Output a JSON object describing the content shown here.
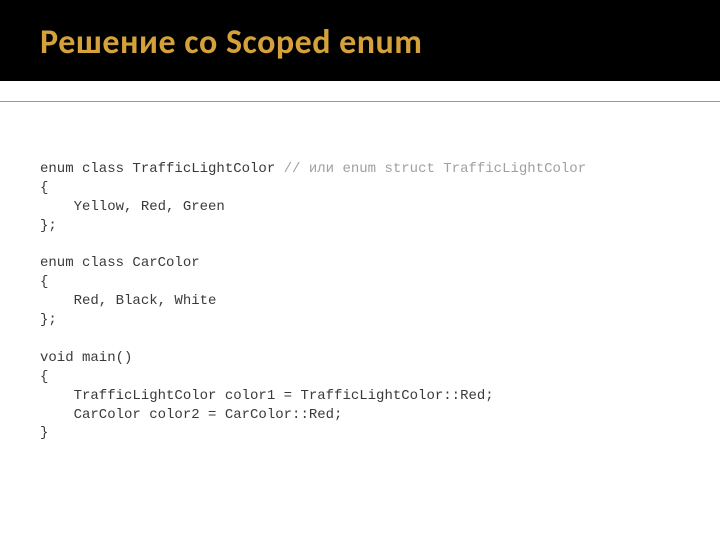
{
  "title": "Решение со Scoped enum",
  "code": {
    "l1a": "enum class TrafficLightColor ",
    "l1c": "// или enum struct TrafficLightColor",
    "l2": "{",
    "l3": "    Yellow, Red, Green",
    "l4": "};",
    "l5": "",
    "l6": "enum class CarColor",
    "l7": "{",
    "l8": "    Red, Black, White",
    "l9": "};",
    "l10": "",
    "l11": "void main()",
    "l12": "{",
    "l13": "    TrafficLightColor color1 = TrafficLightColor::Red;",
    "l14": "    CarColor color2 = CarColor::Red;",
    "l15": "}"
  }
}
